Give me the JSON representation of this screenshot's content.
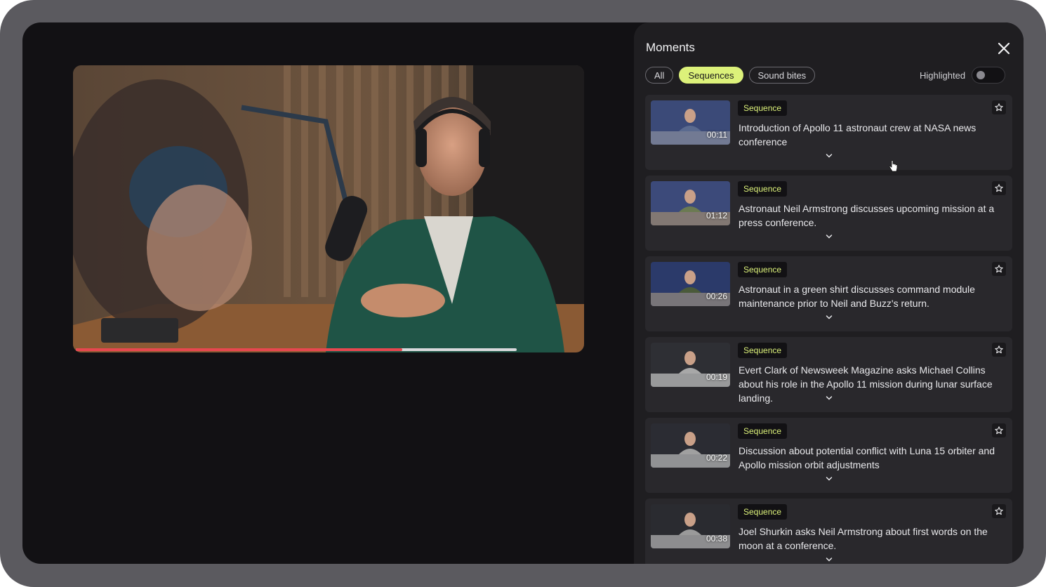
{
  "panel": {
    "title": "Moments",
    "filters": [
      {
        "label": "All",
        "active": false
      },
      {
        "label": "Sequences",
        "active": true
      },
      {
        "label": "Sound bites",
        "active": false
      }
    ],
    "highlighted_label": "Highlighted",
    "highlighted_on": false
  },
  "player": {
    "progress": 0.74,
    "buffered": 1.0
  },
  "colors": {
    "accent": "#dcf17a",
    "progress": "#e8474f",
    "panel_bg": "#1f1e21",
    "card_bg": "#29282c"
  },
  "moments": [
    {
      "tag": "Sequence",
      "duration": "00:11",
      "description": "Introduction of Apollo 11 astronaut crew at NASA news conference"
    },
    {
      "tag": "Sequence",
      "duration": "01:12",
      "description": "Astronaut Neil Armstrong discusses upcoming mission at a press conference."
    },
    {
      "tag": "Sequence",
      "duration": "00:26",
      "description": "Astronaut in a green shirt discusses command module maintenance prior to Neil and Buzz's return."
    },
    {
      "tag": "Sequence",
      "duration": "00:19",
      "description": "Evert Clark of Newsweek Magazine asks Michael Collins about his role in the Apollo 11 mission during lunar surface landing."
    },
    {
      "tag": "Sequence",
      "duration": "00:22",
      "description": "Discussion about potential conflict with Luna 15 orbiter and Apollo mission orbit adjustments"
    },
    {
      "tag": "Sequence",
      "duration": "00:38",
      "description": "Joel Shurkin asks Neil Armstrong about first words on the moon at a conference."
    }
  ],
  "icons": {
    "close": "close-icon",
    "star": "star-icon",
    "expand": "chevron-down-icon"
  }
}
